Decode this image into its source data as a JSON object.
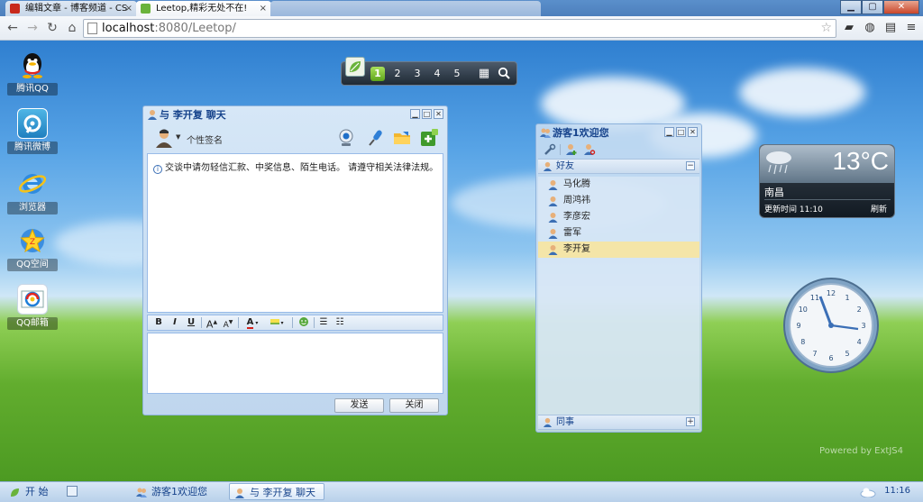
{
  "browser": {
    "tabs": [
      {
        "title": "编辑文章 - 博客频道 - CS"
      },
      {
        "title": "Leetop,精彩无处不在!"
      },
      {
        "title": ""
      }
    ],
    "address": {
      "host": "localhost",
      "path": ":8080/Leetop/"
    }
  },
  "desktop_icons": [
    {
      "label": "腾讯QQ"
    },
    {
      "label": "腾讯微博"
    },
    {
      "label": "浏览器"
    },
    {
      "label": "QQ空间"
    },
    {
      "label": "QQ邮箱"
    }
  ],
  "topbar": {
    "pages": [
      "1",
      "2",
      "3",
      "4",
      "5"
    ],
    "active_page": "1"
  },
  "chat_window": {
    "title": "与 李开复 聊天",
    "signature": "个性签名",
    "notice": "交谈中请勿轻信汇款、中奖信息、陌生电话。 请遵守相关法律法规。",
    "format": {
      "bold": "B",
      "italic": "I",
      "underline": "U",
      "grow": "A",
      "shrink": "A",
      "color": "A"
    },
    "send_label": "发送",
    "close_label": "关闭"
  },
  "friend_window": {
    "title": "游客1欢迎您",
    "groups": [
      {
        "name": "好友",
        "toggle": "−",
        "members": [
          "马化腾",
          "周鸿祎",
          "李彦宏",
          "雷军",
          "李开复"
        ],
        "selected": "李开复"
      },
      {
        "name": "同事",
        "toggle": "+"
      }
    ]
  },
  "weather": {
    "temperature": "13°C",
    "city": "南昌",
    "updated": "更新时间 11:10",
    "refresh_label": "刷新"
  },
  "clock": {
    "numbers": [
      "12",
      "1",
      "2",
      "3",
      "4",
      "5",
      "6",
      "7",
      "8",
      "9",
      "10",
      "11"
    ]
  },
  "powered_by": "Powered by ExtJS4",
  "taskbar": {
    "start_label": "开 始",
    "items": [
      {
        "label": "游客1欢迎您"
      },
      {
        "label": "与 李开复 聊天"
      }
    ],
    "time": "11:16"
  },
  "colors": {
    "accent": "#15428b",
    "selected_row": "#f4e5a8",
    "active_page": "#6cb321"
  }
}
